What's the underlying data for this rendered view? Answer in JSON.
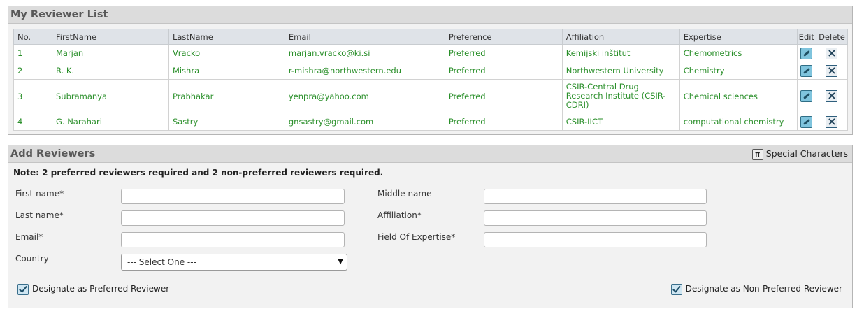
{
  "list_panel": {
    "title": "My Reviewer List",
    "headers": [
      "No.",
      "FirstName",
      "LastName",
      "Email",
      "Preference",
      "Affiliation",
      "Expertise",
      "Edit",
      "Delete"
    ],
    "rows": [
      {
        "no": "1",
        "first": "Marjan",
        "last": "Vracko",
        "email": "marjan.vracko@ki.si",
        "preference": "Preferred",
        "affiliation": "Kemijski inštitut",
        "expertise": "Chemometrics"
      },
      {
        "no": "2",
        "first": "R. K.",
        "last": "Mishra",
        "email": "r-mishra@northwestern.edu",
        "preference": "Preferred",
        "affiliation": "Northwestern University",
        "expertise": "Chemistry"
      },
      {
        "no": "3",
        "first": "Subramanya",
        "last": "Prabhakar",
        "email": "yenpra@yahoo.com",
        "preference": "Preferred",
        "affiliation": "CSIR-Central Drug Research Institute (CSIR-CDRI)",
        "expertise": "Chemical sciences"
      },
      {
        "no": "4",
        "first": "G. Narahari",
        "last": "Sastry",
        "email": "gnsastry@gmail.com",
        "preference": "Preferred",
        "affiliation": "CSIR-IICT",
        "expertise": "computational chemistry"
      }
    ],
    "edit_icon": "edit-pencil-icon",
    "delete_icon": "delete-x-icon",
    "link_color": "#2a8f2a"
  },
  "add_panel": {
    "title": "Add Reviewers",
    "special_chars_label": "Special Characters",
    "special_chars_icon": "pi-icon",
    "note": "Note: 2 preferred reviewers required and 2 non-preferred reviewers required.",
    "fields": {
      "first_name": {
        "label": "First name*",
        "value": ""
      },
      "last_name": {
        "label": "Last name*",
        "value": ""
      },
      "email": {
        "label": "Email*",
        "value": ""
      },
      "country": {
        "label": "Country",
        "selected": "--- Select One ---"
      },
      "middle_name": {
        "label": "Middle name",
        "value": ""
      },
      "affiliation": {
        "label": "Affiliation*",
        "value": ""
      },
      "expertise": {
        "label": "Field Of Expertise*",
        "value": ""
      }
    },
    "preferred_checkbox_label": "Designate as Preferred Reviewer",
    "non_preferred_checkbox_label": "Designate as Non-Preferred Reviewer"
  }
}
